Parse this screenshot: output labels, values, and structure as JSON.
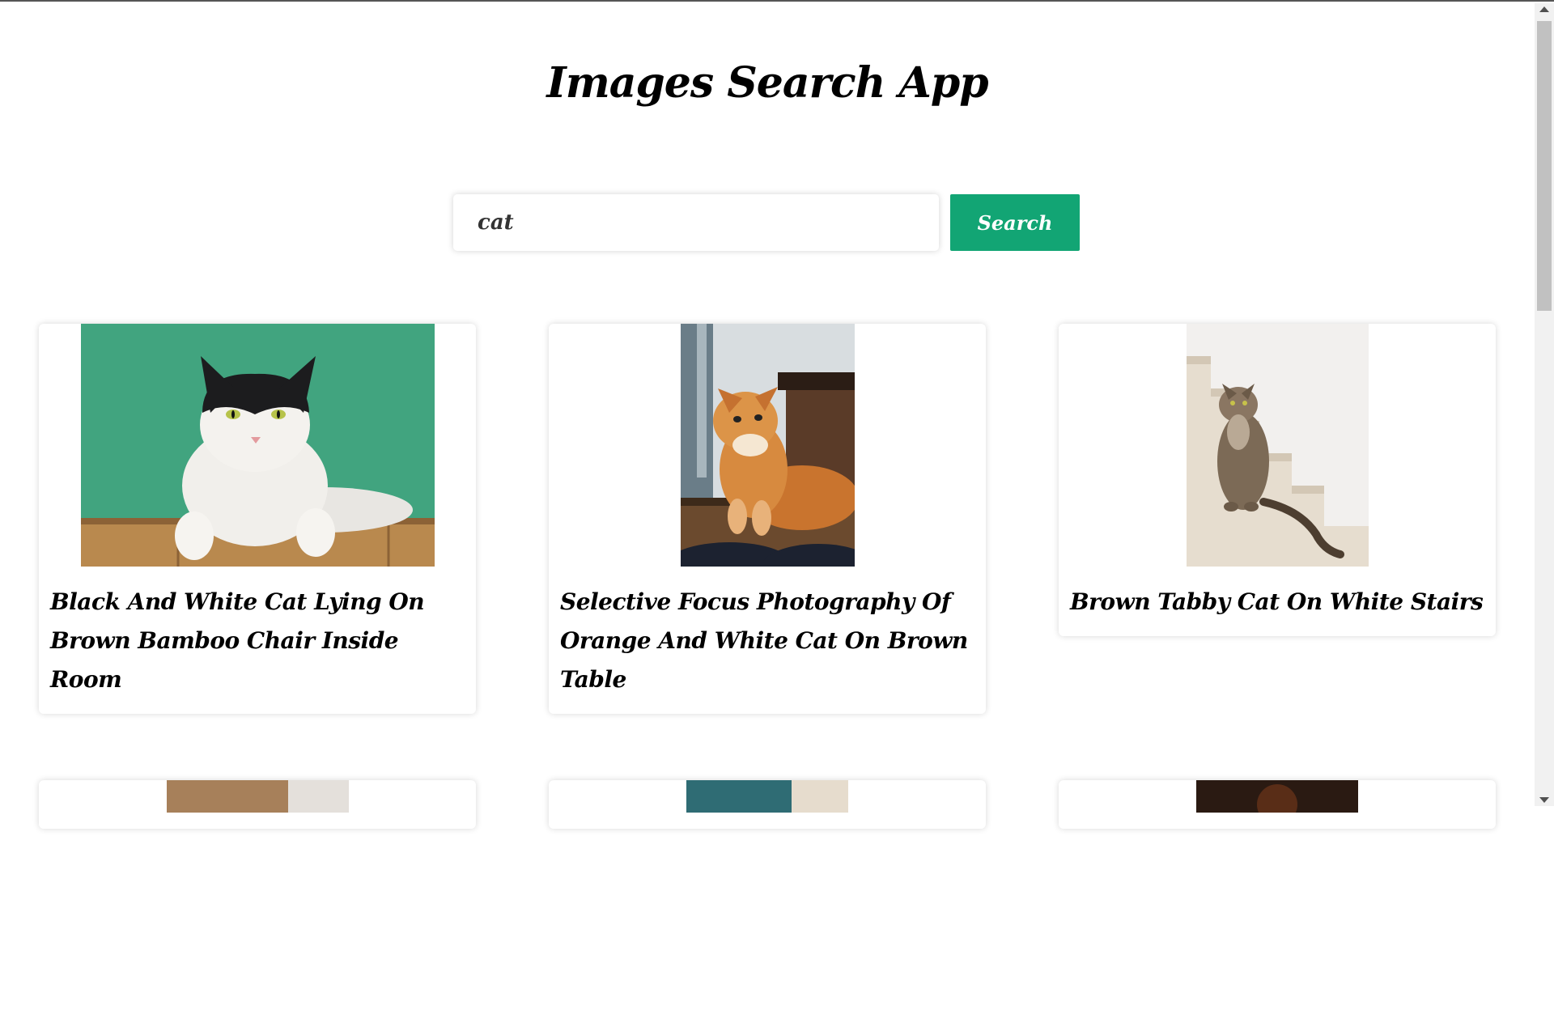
{
  "app": {
    "title": "Images Search App"
  },
  "search": {
    "value": "cat",
    "button_label": "Search"
  },
  "results": [
    {
      "caption": "Black And White Cat Lying On Brown Bamboo Chair Inside Room",
      "icon": "cat-photo-icon"
    },
    {
      "caption": "Selective Focus Photography Of Orange And White Cat On Brown Table",
      "icon": "cat-photo-icon"
    },
    {
      "caption": "Brown Tabby Cat On White Stairs",
      "icon": "cat-photo-icon"
    }
  ],
  "colors": {
    "accent": "#12a574",
    "text": "#000000"
  }
}
